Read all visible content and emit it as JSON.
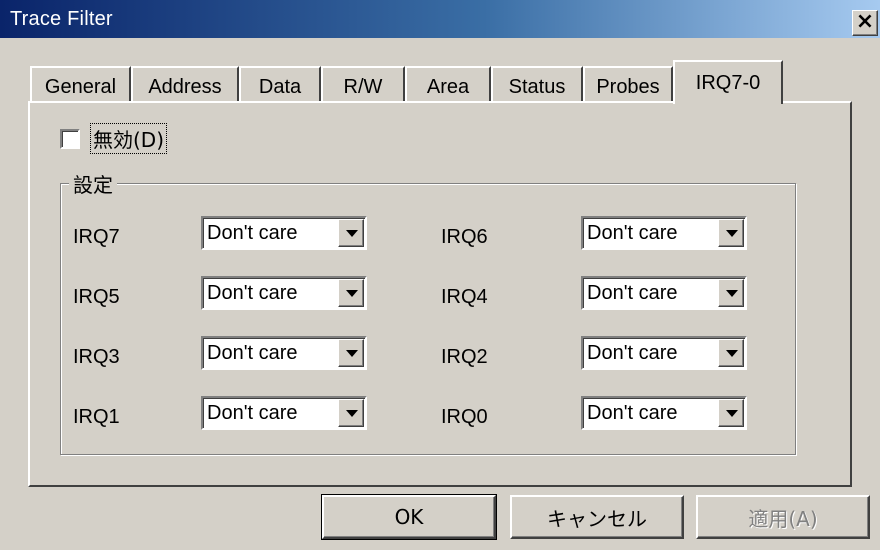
{
  "window": {
    "title": "Trace Filter",
    "close_glyph": "×",
    "close_icon": "close-icon"
  },
  "tabs": [
    {
      "label": "General",
      "active": false
    },
    {
      "label": "Address",
      "active": false
    },
    {
      "label": "Data",
      "active": false
    },
    {
      "label": "R/W",
      "active": false
    },
    {
      "label": "Area",
      "active": false
    },
    {
      "label": "Status",
      "active": false
    },
    {
      "label": "Probes",
      "active": false
    },
    {
      "label": "IRQ7-0",
      "active": true
    }
  ],
  "disable_checkbox": {
    "label": "無効(D)",
    "checked": false
  },
  "settings_group": {
    "title": "設定",
    "rows": [
      {
        "left": {
          "label": "IRQ7",
          "value": "Don't care"
        },
        "right": {
          "label": "IRQ6",
          "value": "Don't care"
        }
      },
      {
        "left": {
          "label": "IRQ5",
          "value": "Don't care"
        },
        "right": {
          "label": "IRQ4",
          "value": "Don't care"
        }
      },
      {
        "left": {
          "label": "IRQ3",
          "value": "Don't care"
        },
        "right": {
          "label": "IRQ2",
          "value": "Don't care"
        }
      },
      {
        "left": {
          "label": "IRQ1",
          "value": "Don't care"
        },
        "right": {
          "label": "IRQ0",
          "value": "Don't care"
        }
      }
    ]
  },
  "buttons": {
    "ok": "OK",
    "cancel": "キャンセル",
    "apply": "適用(A)",
    "apply_disabled": true
  },
  "colors": {
    "face": "#d4d0c8",
    "title_start": "#0a246a",
    "title_end": "#a6caf0"
  }
}
